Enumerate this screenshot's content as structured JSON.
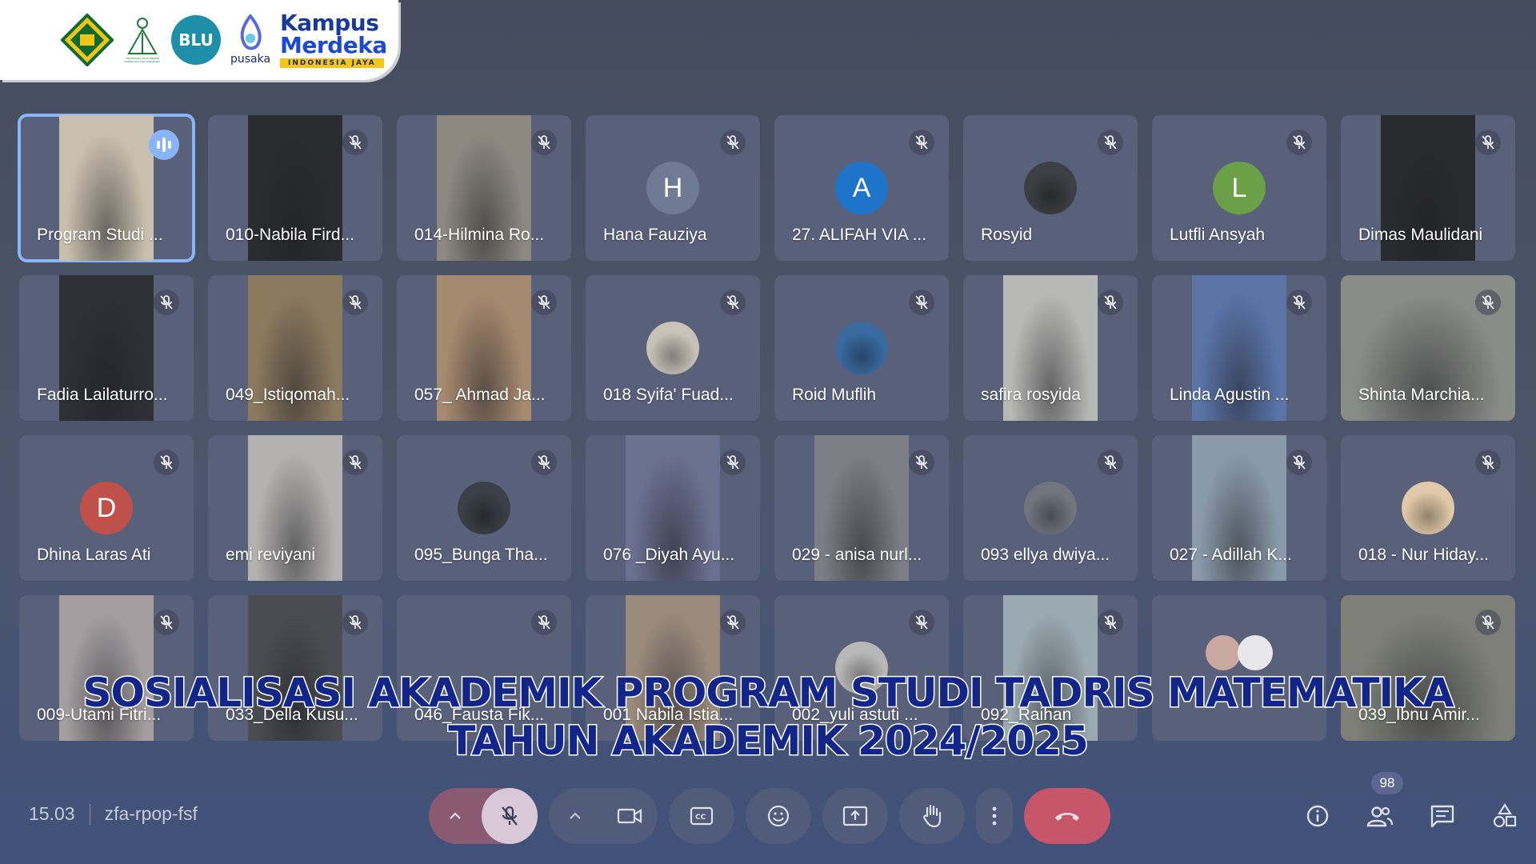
{
  "logos": {
    "kemenag": "kemenag-logo",
    "uin_caption": "UNIVERSITAS ISLAM NEGERI RADEN MAS SAID SURAKARTA",
    "blu_text": "BLU",
    "pusaka_text": "pusaka",
    "kampus_line1": "Kampus",
    "kampus_line2": "Merdeka",
    "kampus_sub": "INDONESIA JAYA"
  },
  "participants": [
    {
      "name": "Program Studi ...",
      "kind": "video",
      "bg": "#c9bfae",
      "active": true
    },
    {
      "name": "010-Nabila Fird...",
      "kind": "video",
      "bg": "#2b2c30"
    },
    {
      "name": "014-Hilmina Ro...",
      "kind": "video",
      "bg": "#8d8880"
    },
    {
      "name": "Hana Fauziya",
      "kind": "avatar",
      "initial": "H",
      "color": "#6f7a94"
    },
    {
      "name": "27. ALIFAH VIA ...",
      "kind": "avatar",
      "initial": "A",
      "color": "#1e74c8"
    },
    {
      "name": "Rosyid",
      "kind": "photo",
      "color": "#3d3f44"
    },
    {
      "name": "Lutfli Ansyah",
      "kind": "avatar",
      "initial": "L",
      "color": "#6aa048"
    },
    {
      "name": "Dimas Maulidani",
      "kind": "video",
      "bg": "#2a2b2f"
    },
    {
      "name": "Fadia Lailaturro...",
      "kind": "video",
      "bg": "#2f3036"
    },
    {
      "name": "049_Istiqomah...",
      "kind": "video",
      "bg": "#8c7a5f"
    },
    {
      "name": "057_ Ahmad Ja...",
      "kind": "video",
      "bg": "#a68a70"
    },
    {
      "name": "018 Syifa' Fuad...",
      "kind": "photo",
      "color": "#c8c2b8"
    },
    {
      "name": "Roid Muflih",
      "kind": "photo",
      "color": "#3a6aa0"
    },
    {
      "name": "safira rosyida",
      "kind": "video",
      "bg": "#b8b8b6"
    },
    {
      "name": "Linda Agustin ...",
      "kind": "video",
      "bg": "#5a74a8"
    },
    {
      "name": "Shinta Marchia...",
      "kind": "video-wide",
      "bg": "#8a8c88"
    },
    {
      "name": "Dhina Laras Ati",
      "kind": "avatar",
      "initial": "D",
      "color": "#c0504a"
    },
    {
      "name": "emi reviyani",
      "kind": "video",
      "bg": "#b4b2b0"
    },
    {
      "name": "095_Bunga Tha...",
      "kind": "photo",
      "color": "#3b4048"
    },
    {
      "name": "076 _Diyah Ayu...",
      "kind": "video",
      "bg": "#6a7090"
    },
    {
      "name": "029 - anisa nurl...",
      "kind": "video",
      "bg": "#7d7f86"
    },
    {
      "name": "093 ellya dwiya...",
      "kind": "photo",
      "color": "#70757e"
    },
    {
      "name": "027 - Adillah K...",
      "kind": "video",
      "bg": "#8a9aaa"
    },
    {
      "name": "018 - Nur Hiday...",
      "kind": "photo",
      "color": "#e0c8a8"
    },
    {
      "name": "009-Utami Fitri...",
      "kind": "video",
      "bg": "#a49ea0"
    },
    {
      "name": "033_Della Kusu...",
      "kind": "video",
      "bg": "#4a4c52"
    },
    {
      "name": "046_Fausta Fik...",
      "kind": "empty"
    },
    {
      "name": "001 Nabila Istia...",
      "kind": "video",
      "bg": "#9a8a7c"
    },
    {
      "name": "002_yuli astuti ...",
      "kind": "photo",
      "color": "#b8b8b8"
    },
    {
      "name": "092_Raihan",
      "kind": "video",
      "bg": "#9aaab0"
    },
    {
      "name": "",
      "kind": "group"
    },
    {
      "name": "039_Ibnu Amir...",
      "kind": "video-wide",
      "bg": "#7e8078"
    }
  ],
  "overlay": {
    "line1": "SOSIALISASI AKADEMIK PROGRAM STUDI TADRIS MATEMATIKA",
    "line2": "TAHUN AKADEMIK 2024/2025"
  },
  "meeting": {
    "time": "15.03",
    "code": "zfa-rpop-fsf"
  },
  "people_count": "98",
  "colors": {
    "accent": "#8ab4f8",
    "end_call": "#c8566a",
    "title_text": "#12268a"
  }
}
